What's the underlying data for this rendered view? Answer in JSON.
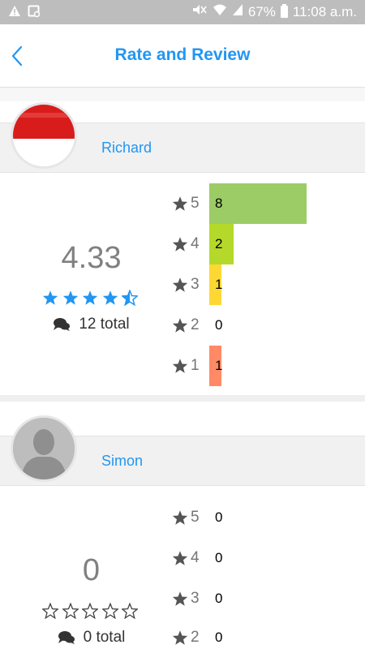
{
  "status_bar": {
    "battery": "67%",
    "time": "11:08 a.m.",
    "left_icons": [
      "warning-icon",
      "image-icon"
    ],
    "right_icons": [
      "mute-icon",
      "wifi-icon",
      "signal-icon",
      "battery-icon"
    ]
  },
  "header": {
    "title": "Rate and Review",
    "back_icon": "chevron-left-icon",
    "accent": "#2196f3"
  },
  "reviews": [
    {
      "name": "Richard",
      "avatar": "flag-red-white",
      "score": "4.33",
      "stars_filled": 4.33,
      "total": "12 total",
      "distribution": [
        {
          "stars": "5",
          "count": "8",
          "value": 8,
          "color": "#9ccc65"
        },
        {
          "stars": "4",
          "count": "2",
          "value": 2,
          "color": "#b4d92a"
        },
        {
          "stars": "3",
          "count": "1",
          "value": 1,
          "color": "#fdd835"
        },
        {
          "stars": "2",
          "count": "0",
          "value": 0,
          "color": "#bdbdbd"
        },
        {
          "stars": "1",
          "count": "1",
          "value": 1,
          "color": "#ff8a65"
        }
      ]
    },
    {
      "name": "Simon",
      "avatar": "default-person",
      "score": "0",
      "stars_filled": 0,
      "total": "0 total",
      "distribution": [
        {
          "stars": "5",
          "count": "0",
          "value": 0
        },
        {
          "stars": "4",
          "count": "0",
          "value": 0
        },
        {
          "stars": "3",
          "count": "0",
          "value": 0
        },
        {
          "stars": "2",
          "count": "0",
          "value": 0
        }
      ]
    }
  ]
}
